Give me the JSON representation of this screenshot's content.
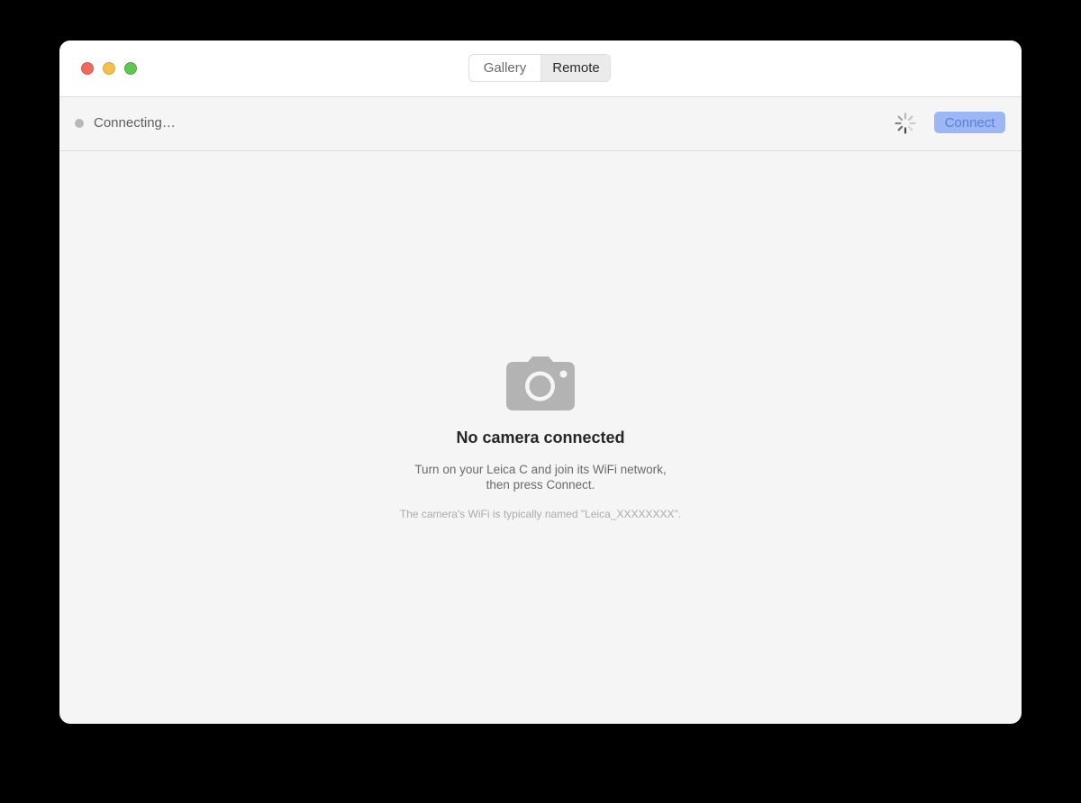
{
  "window": {
    "traffic_lights": {
      "close": "#ec6a5e",
      "minimize": "#f4bf4f",
      "maximize": "#61c554"
    },
    "tabs": [
      {
        "label": "Gallery",
        "selected": false
      },
      {
        "label": "Remote",
        "selected": true
      }
    ]
  },
  "status": {
    "text": "Connecting…",
    "indicator_color": "#b8b8b8",
    "spinner_icon": "activity-spinner",
    "connect_label": "Connect",
    "connect_enabled": false,
    "accent": "#9cb7f4"
  },
  "empty_state": {
    "icon": "camera-icon",
    "title": "No camera connected",
    "description_line1": "Turn on your Leica C and join its WiFi network,",
    "description_line2": "then press Connect.",
    "note": "The camera's WiFi is typically named \"Leica_XXXXXXXX\"."
  }
}
